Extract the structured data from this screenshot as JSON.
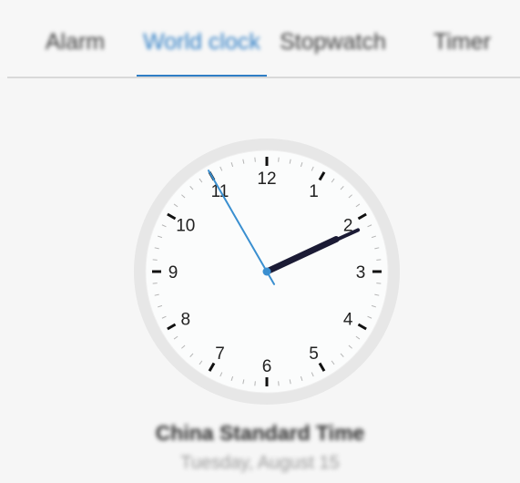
{
  "tabs": [
    {
      "label": "Alarm",
      "active": false
    },
    {
      "label": "World clock",
      "active": true
    },
    {
      "label": "Stopwatch",
      "active": false
    },
    {
      "label": "Timer",
      "active": false
    }
  ],
  "clock": {
    "numerals": [
      "12",
      "1",
      "2",
      "3",
      "4",
      "5",
      "6",
      "7",
      "8",
      "9",
      "10",
      "11"
    ],
    "time": {
      "hour": 2,
      "minute": 10,
      "second": 55
    },
    "colors": {
      "face": "#fbfcfc",
      "rim": "#e7e7e7",
      "hour_hand": "#1b1b35",
      "minute_hand": "#1b1b35",
      "second_hand": "#3a8fd0",
      "center_dot": "#3a8fd0"
    }
  },
  "timezone": {
    "name": "China Standard Time",
    "date": "Tuesday, August 15"
  },
  "colors": {
    "accent": "#2f7ec5",
    "background": "#f6f6f6"
  }
}
